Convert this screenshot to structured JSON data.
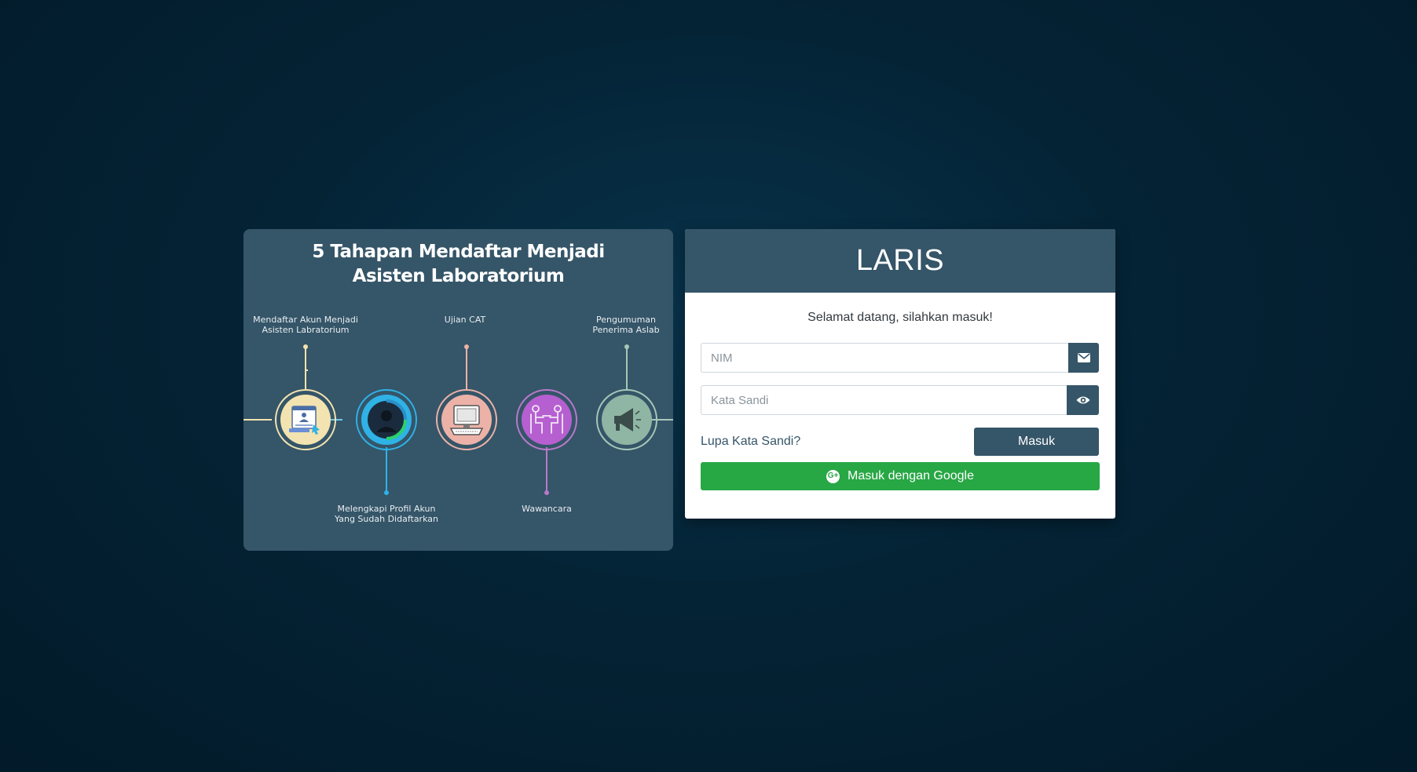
{
  "infographic": {
    "title_line1": "5 Tahapan Mendaftar Menjadi",
    "title_line2": "Asisten Laboratorium",
    "steps": [
      {
        "label_line1": "Mendaftar Akun Menjadi",
        "label_line2": "Asisten Labratorium",
        "icon": "registration-form-icon",
        "color": "#f3e3b0"
      },
      {
        "label_line1": "Melengkapi Profil Akun",
        "label_line2": "Yang Sudah Didaftarkan",
        "icon": "user-profile-icon",
        "color": "#2fb2e6"
      },
      {
        "label_line1": "Ujian CAT",
        "label_line2": "",
        "icon": "computer-icon",
        "color": "#ecb2a8"
      },
      {
        "label_line1": "Wawancara",
        "label_line2": "",
        "icon": "interview-icon",
        "color": "#b65fd0"
      },
      {
        "label_line1": "Pengumuman",
        "label_line2": "Penerima Aslab",
        "icon": "megaphone-icon",
        "color": "#8fb6a4"
      }
    ]
  },
  "login": {
    "app_title": "LARIS",
    "welcome_text": "Selamat datang, silahkan masuk!",
    "nim_placeholder": "NIM",
    "nim_icon": "envelope-icon",
    "password_placeholder": "Kata Sandi",
    "password_icon": "eye-icon",
    "forgot_label": "Lupa Kata Sandi?",
    "submit_label": "Masuk",
    "google_label": "Masuk dengan Google",
    "google_icon": "google-plus-icon"
  },
  "colors": {
    "primary": "#355568",
    "google_green": "#28a745",
    "background": "#042335"
  }
}
